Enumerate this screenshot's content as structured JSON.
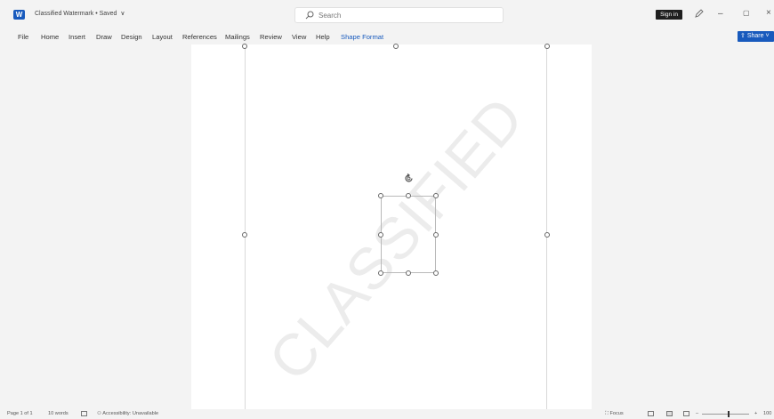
{
  "titlebar": {
    "app_icon": "W",
    "doc_title": "Classified Watermark • Saved",
    "title_chevron": "∨",
    "search_placeholder": "Search",
    "sign_in": "Sign in",
    "minimize": "–",
    "restore": "▢",
    "close": "×"
  },
  "ribbon": {
    "tabs": [
      "File",
      "Home",
      "Insert",
      "Draw",
      "Design",
      "Layout",
      "References",
      "Mailings",
      "Review",
      "View",
      "Help",
      "Shape Format"
    ],
    "active_tab": "Shape Format",
    "share": "Share"
  },
  "document": {
    "watermark_text": "CLASSIFIED"
  },
  "statusbar": {
    "page_info": "Page 1 of 1",
    "word_count": "10 words",
    "accessibility": "Accessibility: Unavailable",
    "focus": "Focus",
    "zoom_minus": "–",
    "zoom_plus": "+",
    "zoom_level": "100"
  },
  "colors": {
    "accent": "#185abd",
    "watermark": "#ececec"
  }
}
